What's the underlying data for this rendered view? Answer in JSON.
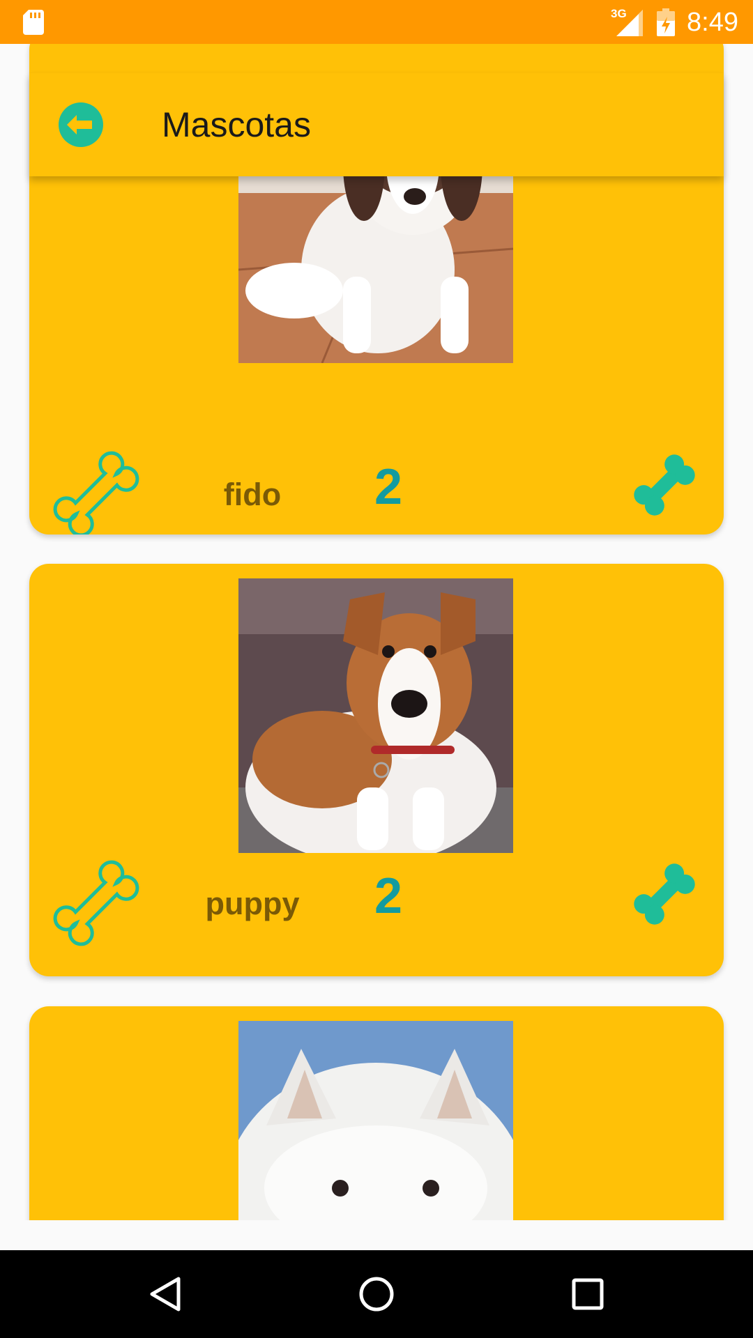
{
  "status_bar": {
    "time": "8:49",
    "network": "3G",
    "background_color": "#ff9800",
    "icons": [
      "sd-card-icon",
      "signal-icon",
      "battery-charging-icon"
    ]
  },
  "toolbar": {
    "title": "Mascotas",
    "back_icon": "arrow-left-circle-icon",
    "background_color": "#ffc107"
  },
  "pets": [
    {
      "name": "fido",
      "likes": "2",
      "photo": "beagle puppy"
    },
    {
      "name": "puppy",
      "likes": "2",
      "photo": "jack russell terrier"
    },
    {
      "name": "",
      "likes": "",
      "photo": "white westie"
    }
  ],
  "icons": {
    "like_button": "bone-outline-icon",
    "rating_icon": "bone-filled-icon"
  },
  "colors": {
    "card": "#ffc107",
    "accent": "#1fbd99",
    "count": "#139ba0",
    "name": "#7a5a06"
  },
  "nav_bar": {
    "buttons": [
      "back-triangle-icon",
      "home-circle-icon",
      "recents-square-icon"
    ]
  }
}
